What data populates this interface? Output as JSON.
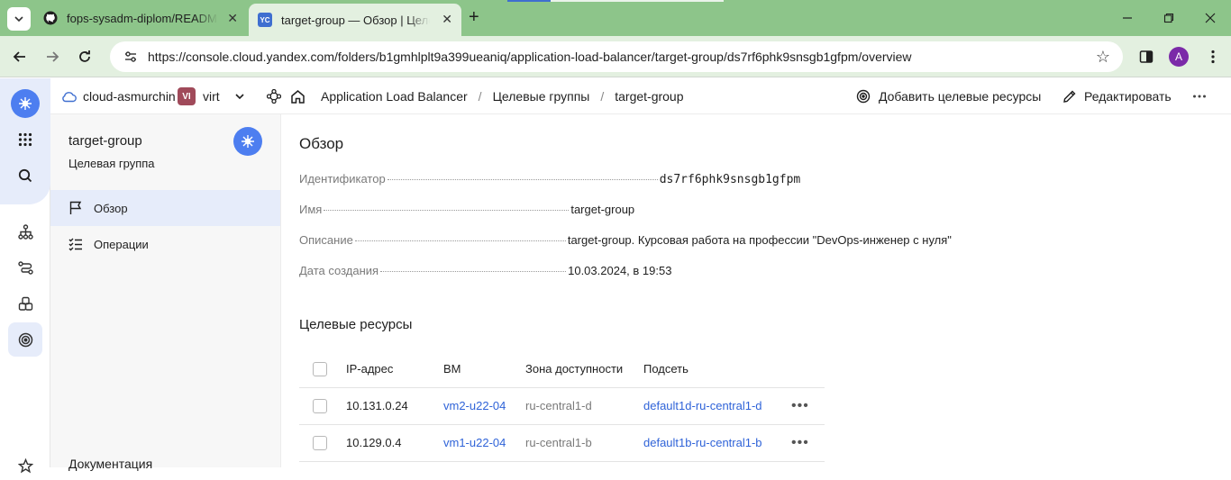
{
  "browser": {
    "tabs": [
      {
        "title": "fops-sysadm-diplom/README.md",
        "active": false,
        "icon": "github-icon"
      },
      {
        "title": "target-group — Обзор | Целевые группы",
        "active": true,
        "icon": "yc-icon",
        "favicon_text": "YC"
      }
    ],
    "url": "https://console.cloud.yandex.com/folders/b1gmhlplt9a399ueaniq/application-load-balancer/target-group/ds7rf6phk9snsgb1gfpm/overview",
    "profile_initial": "A"
  },
  "header": {
    "cloud": "cloud-asmurchin",
    "folder_badge": "VI",
    "folder": "virt",
    "breadcrumbs": [
      "Application Load Balancer",
      "Целевые группы",
      "target-group"
    ],
    "actions": {
      "add_targets": "Добавить целевые ресурсы",
      "edit": "Редактировать"
    }
  },
  "sidebar": {
    "title": "target-group",
    "subtitle": "Целевая группа",
    "items": [
      {
        "label": "Обзор",
        "icon": "flag-icon",
        "active": true
      },
      {
        "label": "Операции",
        "icon": "checklist-icon",
        "active": false
      }
    ],
    "footer": "Документация"
  },
  "overview": {
    "title": "Обзор",
    "fields": [
      {
        "label": "Идентификатор",
        "value": "ds7rf6phk9snsgb1gfpm"
      },
      {
        "label": "Имя",
        "value": "target-group"
      },
      {
        "label": "Описание",
        "value": "target-group. Курсовая работа на профессии \"DevOps-инженер с нуля\""
      },
      {
        "label": "Дата создания",
        "value": "10.03.2024, в 19:53"
      }
    ]
  },
  "targets": {
    "title": "Целевые ресурсы",
    "columns": [
      "IP-адрес",
      "ВМ",
      "Зона доступности",
      "Подсеть"
    ],
    "rows": [
      {
        "ip": "10.131.0.24",
        "vm": "vm2-u22-04",
        "zone": "ru-central1-d",
        "subnet": "default1d-ru-central1-d"
      },
      {
        "ip": "10.129.0.4",
        "vm": "vm1-u22-04",
        "zone": "ru-central1-b",
        "subnet": "default1b-ru-central1-b"
      }
    ]
  },
  "colors": {
    "accent": "#4d7ef0",
    "link": "#2f63d8",
    "tabbar": "#8dc58a",
    "toolbar": "#e3f0e0"
  }
}
